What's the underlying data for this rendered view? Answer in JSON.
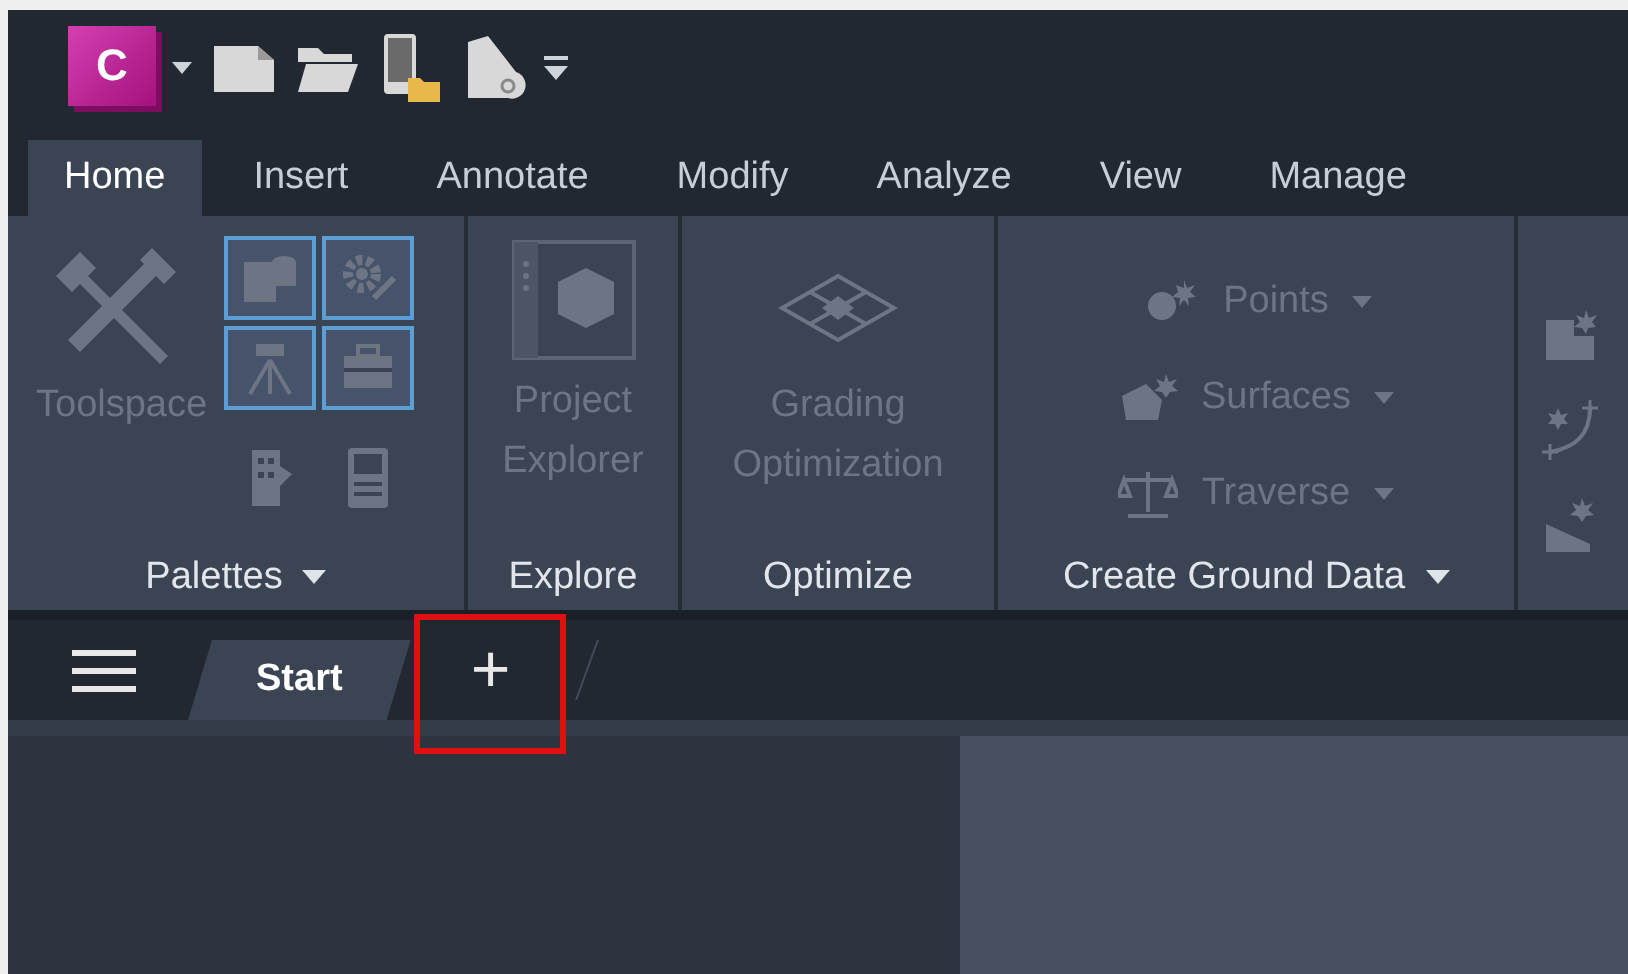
{
  "quick_access": {
    "app_letter": "C"
  },
  "ribbon_tabs": [
    {
      "label": "Home",
      "selected": true
    },
    {
      "label": "Insert",
      "selected": false
    },
    {
      "label": "Annotate",
      "selected": false
    },
    {
      "label": "Modify",
      "selected": false
    },
    {
      "label": "Analyze",
      "selected": false
    },
    {
      "label": "View",
      "selected": false
    },
    {
      "label": "Manage",
      "selected": false
    }
  ],
  "panels": [
    {
      "kind": "palettes",
      "title": "Palettes",
      "has_menu": true,
      "tool": {
        "label": "Toolspace",
        "disabled": true
      },
      "grid": [
        {
          "on": true
        },
        {
          "on": true
        },
        {
          "on": true
        },
        {
          "on": true
        },
        {
          "on": false
        },
        {
          "on": false
        }
      ]
    },
    {
      "kind": "big",
      "title": "Explore",
      "has_menu": false,
      "tool": {
        "label": "Project Explorer",
        "disabled": true
      }
    },
    {
      "kind": "big",
      "title": "Optimize",
      "has_menu": false,
      "tool": {
        "label": "Grading Optimization",
        "disabled": true
      }
    },
    {
      "kind": "stack",
      "title": "Create Ground Data",
      "has_menu": true,
      "items": [
        {
          "label": "Points",
          "disabled": true
        },
        {
          "label": "Surfaces",
          "disabled": true
        },
        {
          "label": "Traverse",
          "disabled": true
        }
      ]
    },
    {
      "kind": "icons"
    }
  ],
  "doc_tabs": [
    {
      "label": "Start",
      "selected": true
    }
  ],
  "new_tab": {
    "label": "+",
    "highlighted": true
  }
}
